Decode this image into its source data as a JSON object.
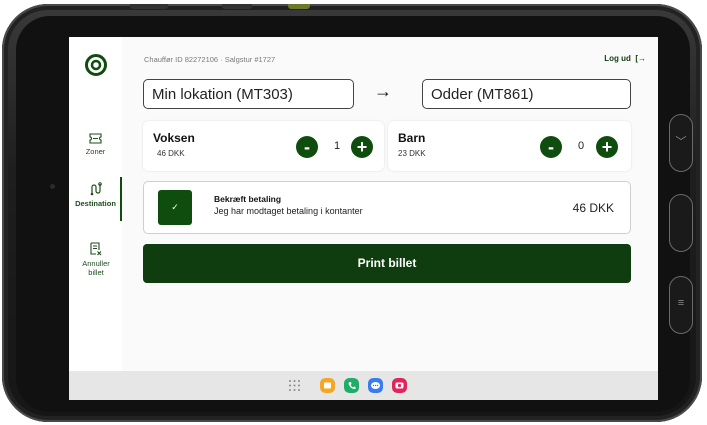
{
  "header": {
    "info": "Chauffør ID 82272106 · Salgstur #1727",
    "logout_label": "Log ud",
    "logout_icon": "logout-arrow-icon"
  },
  "sidebar": {
    "items": [
      {
        "label": "Zoner",
        "icon": "ticket-icon"
      },
      {
        "label": "Destination",
        "icon": "route-icon",
        "active": true
      },
      {
        "label": "Annuller billet",
        "icon": "receipt-cancel-icon"
      }
    ]
  },
  "route": {
    "from": "Min lokation (MT303)",
    "arrow": "→",
    "to": "Odder (MT861)"
  },
  "passengers": [
    {
      "title": "Voksen",
      "price": "46 DKK",
      "count": "1"
    },
    {
      "title": "Barn",
      "price": "23 DKK",
      "count": "0"
    }
  ],
  "stepper": {
    "minus": "-",
    "plus": "+"
  },
  "payment": {
    "check": "✓",
    "title": "Bekræft betaling",
    "subtitle": "Jeg har modtaget betaling i kontanter",
    "amount": "46 DKK"
  },
  "print_label": "Print billet",
  "colors": {
    "primary": "#0f4d0f",
    "primary_dark": "#0f3d0f",
    "background": "#f5f5f5"
  },
  "taskbar": {
    "apps": [
      {
        "name": "app-grid-icon",
        "color": "#8a8a8a"
      },
      {
        "name": "my-files-icon",
        "color": "#f5a623"
      },
      {
        "name": "phone-icon",
        "color": "#1fae6a"
      },
      {
        "name": "messages-icon",
        "color": "#3a7bf0"
      },
      {
        "name": "camera-icon",
        "color": "#e0245e"
      }
    ]
  }
}
